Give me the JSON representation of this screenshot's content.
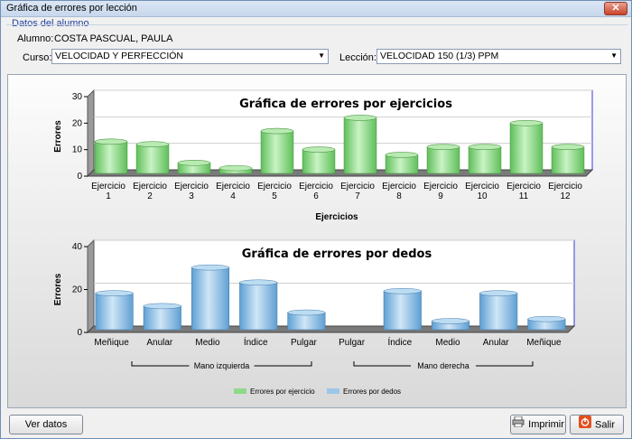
{
  "window": {
    "title": "Gráfica de errores por lección",
    "close_label": "✕"
  },
  "group": {
    "label": "Datos del alumno"
  },
  "student": {
    "label": "Alumno:",
    "value": "COSTA PASCUAL, PAULA"
  },
  "course": {
    "label": "Curso:",
    "value": "VELOCIDAD Y PERFECCIÓN"
  },
  "lesson": {
    "label": "Lección:",
    "value": "VELOCIDAD 150 (1/3) PPM"
  },
  "buttons": {
    "ver_datos": "Ver datos",
    "imprimir": "Imprimir",
    "salir": "Salir"
  },
  "icons": {
    "printer": "printer-icon",
    "exit": "exit-icon"
  },
  "colors": {
    "green": "#8fd989",
    "blue": "#9bc6e8"
  },
  "chart_data": [
    {
      "type": "bar",
      "title": "Gráfica de errores por ejercicios",
      "xlabel": "Ejercicios",
      "ylabel": "Errores",
      "ylim": [
        0,
        30
      ],
      "yticks": [
        "0",
        "10",
        "20",
        "30"
      ],
      "categories": [
        "Ejercicio 1",
        "Ejercicio 2",
        "Ejercicio 3",
        "Ejercicio 4",
        "Ejercicio 5",
        "Ejercicio 6",
        "Ejercicio 7",
        "Ejercicio 8",
        "Ejercicio 9",
        "Ejercicio 10",
        "Ejercicio 11",
        "Ejercicio 12"
      ],
      "series": [
        {
          "name": "Errores por ejercicio",
          "values": [
            12,
            11,
            4,
            2,
            16,
            9,
            21,
            7,
            10,
            10,
            19,
            10
          ]
        }
      ]
    },
    {
      "type": "bar",
      "title": "Gráfica de errores por dedos",
      "xlabel": "",
      "ylabel": "Errores",
      "ylim": [
        0,
        40
      ],
      "yticks": [
        "0",
        "20",
        "40"
      ],
      "categories": [
        "Meñique",
        "Anular",
        "Medio",
        "Índice",
        "Pulgar",
        "Pulgar",
        "Índice",
        "Medio",
        "Anular",
        "Meñique"
      ],
      "groups": [
        "Mano izquierda",
        "Mano derecha"
      ],
      "series": [
        {
          "name": "Errores por dedos",
          "values": [
            17,
            11,
            29,
            22,
            8,
            0,
            18,
            4,
            17,
            5
          ]
        }
      ]
    }
  ],
  "legend": [
    "Errores por ejercicio",
    "Errores por dedos"
  ]
}
